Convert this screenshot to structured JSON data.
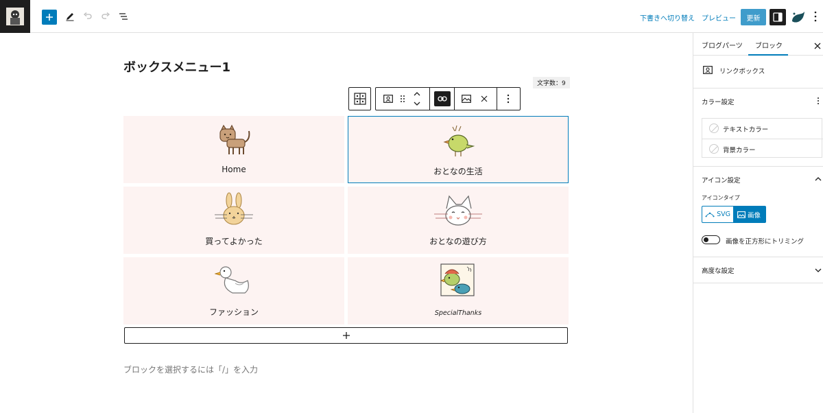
{
  "topbar": {
    "draft_switch_label": "下書きへ切り替え",
    "preview_label": "プレビュー",
    "update_label": "更新"
  },
  "editor": {
    "post_title": "ボックスメニュー1",
    "char_count": "文字数：9",
    "placeholder": "ブロックを選択するには「/」を入力"
  },
  "menu_items": [
    {
      "label": "Home",
      "icon": "cat-icon"
    },
    {
      "label": "おとなの生活",
      "icon": "bird-icon"
    },
    {
      "label": "買ってよかった",
      "icon": "rabbit-icon"
    },
    {
      "label": "おとなの遊び方",
      "icon": "cat-face-icon"
    },
    {
      "label": "ファッション",
      "icon": "duck-icon"
    },
    {
      "label": "SpecialThanks",
      "icon": "birds-picture-icon"
    }
  ],
  "sidebar": {
    "tabs": [
      {
        "label": "ブログパーツ"
      },
      {
        "label": "ブロック"
      }
    ],
    "block_name": "リンクボックス",
    "color_settings": {
      "title": "カラー設定",
      "text_color_label": "テキストカラー",
      "bg_color_label": "背景カラー"
    },
    "icon_settings": {
      "title": "アイコン設定",
      "icon_type_label": "アイコンタイプ",
      "svg_option": "SVG",
      "image_option": "画像",
      "crop_toggle_label": "画像を正方形にトリミング"
    },
    "advanced_title": "高度な設定"
  },
  "colors": {
    "accent": "#007cba",
    "cell_bg": "#fdf3f2",
    "dark": "#1e1e1e"
  }
}
